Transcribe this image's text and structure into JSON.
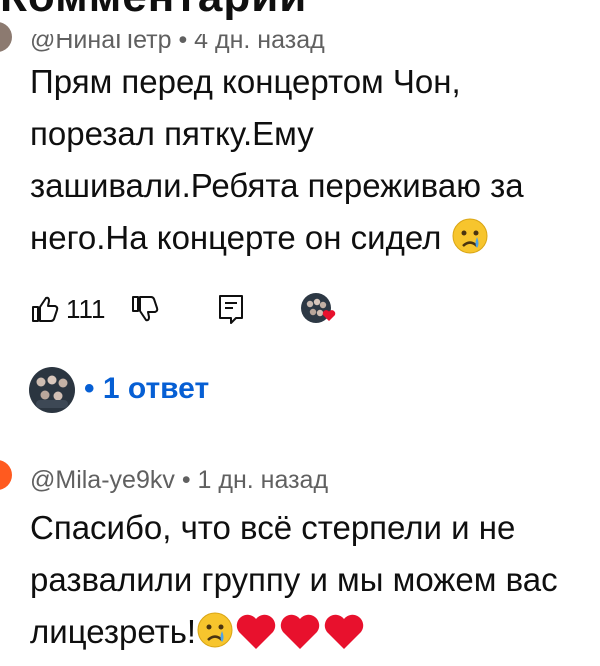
{
  "header": {
    "title": "Комментарии"
  },
  "comments": [
    {
      "author": "@НинаПетр",
      "time": "4 дн. назад",
      "text": "Прям перед концертом Чон, порезал пятку.Ему зашивали.Ребята переживаю за него.На концерте он сидел",
      "emoji": "crying-face",
      "likes": "111",
      "replies_label": "1 ответ"
    },
    {
      "author": "@Mila-ye9kv",
      "time": "1 дн. назад",
      "text": "Спасибо, что всё стерпели и не развалили группу и мы можем вас лицезреть!",
      "emoji": "crying-face",
      "hearts": 3
    }
  ],
  "colors": {
    "link": "#065fd4",
    "meta": "#606060",
    "heart": "#e8112d",
    "emoji": "#f7c52d"
  }
}
